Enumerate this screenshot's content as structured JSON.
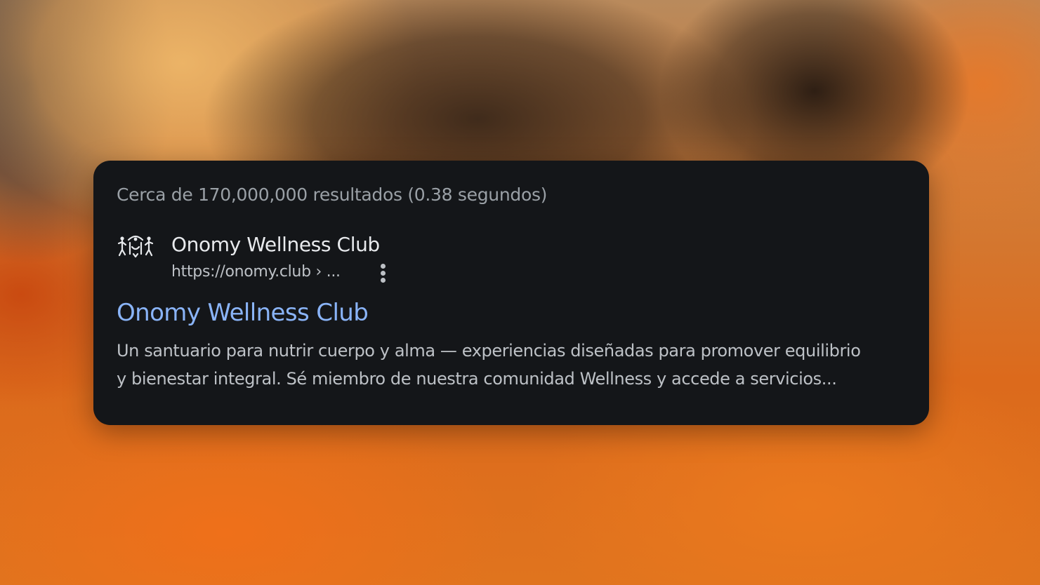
{
  "results_stats": "Cerca de 170,000,000 resultados (0.38 segundos)",
  "result": {
    "favicon_icon": "onomy-logo-icon",
    "site_name": "Onomy Wellness Club",
    "site_url": "https://onomy.club › ...",
    "more_icon": "more-vert-icon",
    "title": "Onomy Wellness Club",
    "snippet_lines": [
      "Un santuario para nutrir cuerpo y alma — experiencias diseñadas para promover equilibrio",
      "y bienestar integral. Sé miembro de nuestra comunidad Wellness y accede a servicios..."
    ]
  },
  "colors": {
    "card_background": "#141619",
    "title_link": "#8ab4f8",
    "site_name": "#e8eaed",
    "secondary_text": "#9aa0a6",
    "body_text": "#bdc1c6"
  }
}
